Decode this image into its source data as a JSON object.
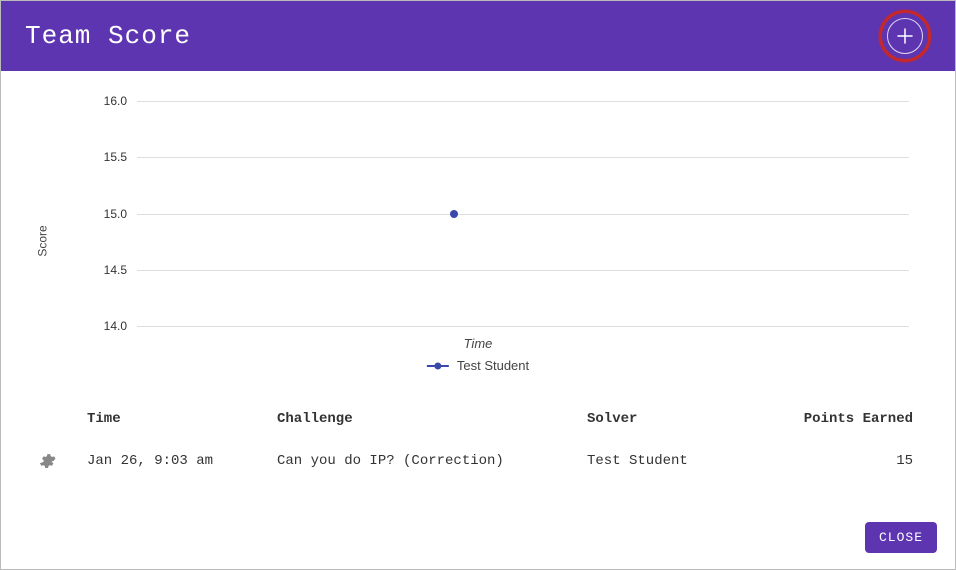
{
  "header": {
    "title": "Team Score",
    "add_icon_label": "+"
  },
  "chart_data": {
    "type": "scatter",
    "title": "",
    "xlabel": "Time",
    "ylabel": "Score",
    "ylim": [
      14.0,
      16.0
    ],
    "y_ticks": [
      14.0,
      14.5,
      15.0,
      15.5,
      16.0
    ],
    "y_tick_labels": [
      "14.0",
      "14.5",
      "15.0",
      "15.5",
      "16.0"
    ],
    "series": [
      {
        "name": "Test Student",
        "x": [
          "Jan 26, 9:03 am"
        ],
        "values": [
          15.0
        ],
        "color": "#3949AB"
      }
    ]
  },
  "table": {
    "columns": {
      "time": "Time",
      "challenge": "Challenge",
      "solver": "Solver",
      "points": "Points Earned"
    },
    "rows": [
      {
        "time": "Jan 26, 9:03 am",
        "challenge": "Can you do IP? (Correction)",
        "solver": "Test Student",
        "points": "15"
      }
    ]
  },
  "footer": {
    "close_label": "CLOSE"
  }
}
